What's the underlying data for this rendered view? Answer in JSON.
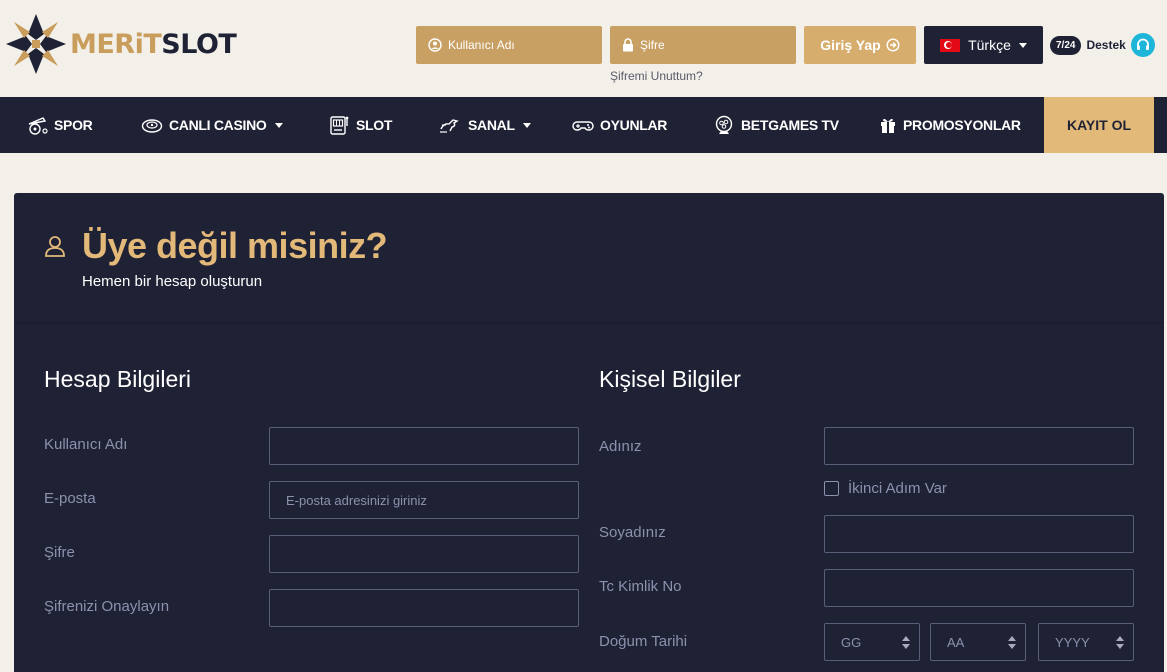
{
  "brand": {
    "part1": "MERiT",
    "part2": "SLOT"
  },
  "header": {
    "username_placeholder": "Kullanıcı Adı",
    "password_placeholder": "Şifre",
    "forgot_password": "Şifremi Unuttum?",
    "login_label": "Giriş Yap",
    "language": "Türkçe",
    "support_badge": "7/24",
    "support_label": "Destek"
  },
  "nav": {
    "items": [
      {
        "label": "SPOR",
        "icon": "sports-icon"
      },
      {
        "label": "CANLI CASINO",
        "icon": "roulette-icon",
        "dropdown": true
      },
      {
        "label": "SLOT",
        "icon": "slot-machine-icon"
      },
      {
        "label": "SANAL",
        "icon": "virtual-horse-icon",
        "dropdown": true
      },
      {
        "label": "OYUNLAR",
        "icon": "gamepad-icon"
      },
      {
        "label": "BETGAMES TV",
        "icon": "lottery-ball-icon"
      },
      {
        "label": "PROMOSYONLAR",
        "icon": "gift-icon"
      }
    ],
    "register_label": "KAYIT OL"
  },
  "form": {
    "title": "Üye değil misiniz?",
    "subtitle": "Hemen bir hesap oluşturun",
    "account": {
      "title": "Hesap Bilgileri",
      "username_label": "Kullanıcı Adı",
      "email_label": "E-posta",
      "email_placeholder": "E-posta adresinizi giriniz",
      "password_label": "Şifre",
      "password_confirm_label": "Şifrenizi Onaylayın"
    },
    "personal": {
      "title": "Kişisel Bilgiler",
      "firstname_label": "Adınız",
      "second_name_checkbox": "İkinci Adım Var",
      "lastname_label": "Soyadınız",
      "tc_label": "Tc Kimlik No",
      "birthdate_label": "Doğum Tarihi",
      "day": "GG",
      "month": "AA",
      "year": "YYYY"
    }
  },
  "colors": {
    "navy": "#1f2235",
    "gold": "#c9a064",
    "gold_light": "#e2b978",
    "background": "#f3f0ea",
    "support_cyan": "#1db5d8"
  }
}
